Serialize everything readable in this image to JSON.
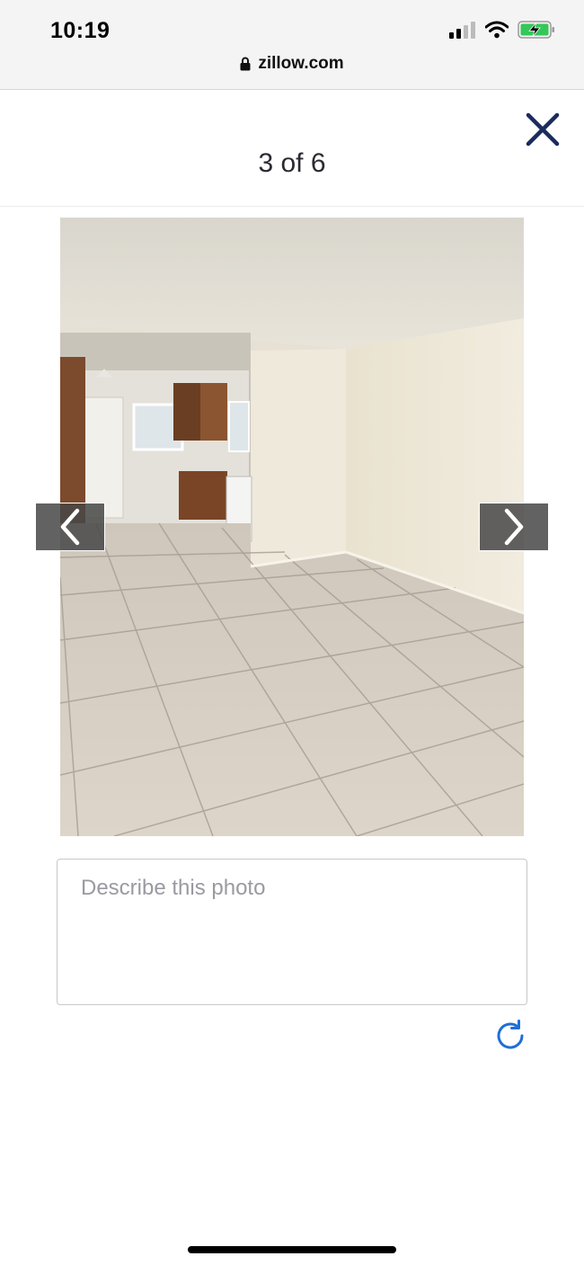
{
  "status_bar": {
    "time": "10:19",
    "icons": [
      "signal-icon",
      "wifi-icon",
      "battery-charging-icon"
    ]
  },
  "browser": {
    "url": "zillow.com",
    "lock_icon": "lock-icon"
  },
  "viewer": {
    "counter": "3 of 6",
    "close_icon": "close-icon",
    "prev_icon": "chevron-left-icon",
    "next_icon": "chevron-right-icon",
    "photo_subject": "empty room with tile floor and kitchen view"
  },
  "caption": {
    "value": "",
    "placeholder": "Describe this photo"
  },
  "refresh_icon": "refresh-icon",
  "colors": {
    "accent_blue": "#1f6fd6",
    "close_navy": "#1b2b5e",
    "battery_green": "#34c759"
  }
}
